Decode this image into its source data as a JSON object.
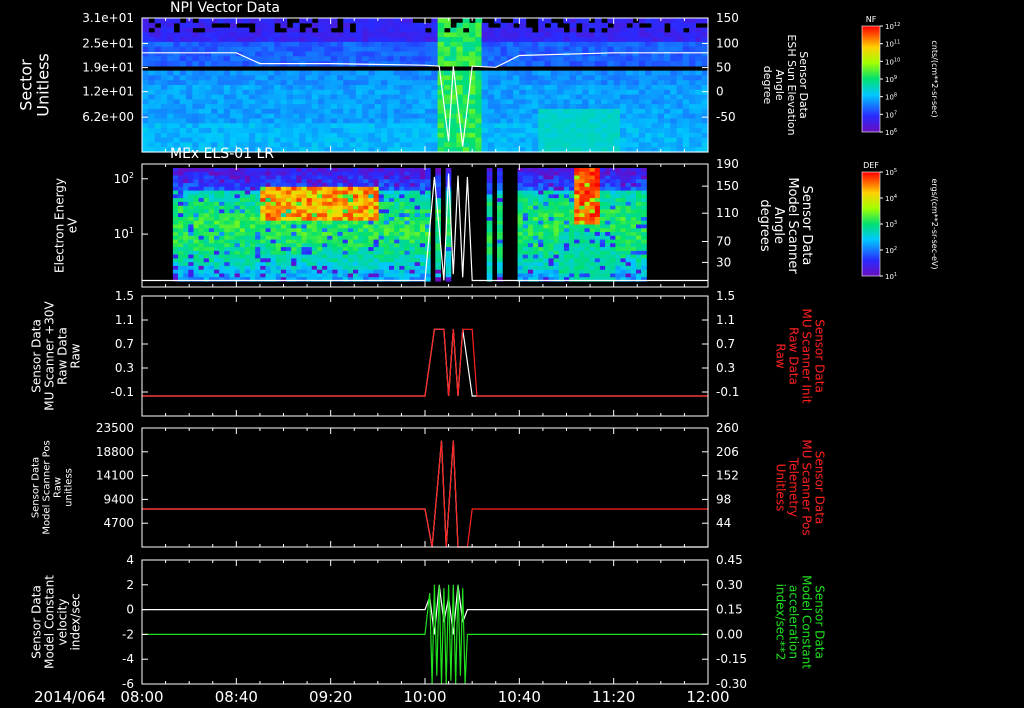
{
  "footer": {
    "date_label": "2014/064",
    "time_ticks": [
      "08:00",
      "08:40",
      "09:20",
      "10:00",
      "10:40",
      "11:20",
      "12:00"
    ]
  },
  "chart_data": [
    {
      "type": "heatmap",
      "title": "NPI Vector Data",
      "ylabel_left": "Sector\nUnitless",
      "yticks_left": [
        "3.1e+01",
        "2.5e+01",
        "1.9e+01",
        "1.2e+01",
        "6.2e+00"
      ],
      "ylabel_right": "Sensor Data\nESH Sun Elevation\nAngle\ndegree",
      "yticks_right": [
        "150",
        "100",
        "50",
        "0",
        "-50"
      ],
      "ylim_right": [
        -100,
        150
      ],
      "overlay_line": {
        "name": "ESH Sun Elevation Angle",
        "color": "#ffffff",
        "x": [
          "08:00",
          "08:40",
          "08:50",
          "09:20",
          "10:00",
          "10:06",
          "10:10",
          "10:12",
          "10:16",
          "10:20",
          "10:30",
          "10:40",
          "11:20",
          "12:00"
        ],
        "y": [
          85,
          85,
          65,
          65,
          62,
          60,
          -80,
          60,
          -90,
          60,
          58,
          80,
          85,
          85
        ]
      },
      "colorbar": {
        "label": "NF",
        "units": "cnts/(cm**2-sr-sec)",
        "ticks": [
          "10^12",
          "10^11",
          "10^10",
          "10^9",
          "10^8",
          "10^7",
          "10^6"
        ]
      }
    },
    {
      "type": "heatmap",
      "title": "MEx ELS-01 LR",
      "ylabel_left": "Electron Energy\neV",
      "yticks_left": [
        "10^2",
        "10^1"
      ],
      "ylabel_right": "Sensor Data\nModel Scanner\nAngle\ndegrees",
      "yticks_right": [
        "190",
        "150",
        "110",
        "70",
        "30"
      ],
      "ylim_right": [
        0,
        190
      ],
      "overlay_line": {
        "name": "Model Scanner Angle",
        "color": "#ffffff",
        "x": [
          "08:00",
          "10:00",
          "10:04",
          "10:08",
          "10:10",
          "10:12",
          "10:14",
          "10:16",
          "10:18",
          "10:20",
          "12:00"
        ],
        "y": [
          10,
          10,
          170,
          10,
          175,
          20,
          172,
          15,
          170,
          10,
          10
        ]
      },
      "colorbar": {
        "label": "DEF",
        "units": "ergs/(cm**2-sr-sec-eV)",
        "ticks": [
          "10^5",
          "10^4",
          "10^3",
          "10^2",
          "10^1"
        ]
      }
    },
    {
      "type": "line",
      "ylabel_left": "Sensor Data\nMU Scanner +30V\nRaw Data\nRaw",
      "yticks_left": [
        "1.5",
        "1.1",
        "0.7",
        "0.3",
        "-0.1"
      ],
      "ylim": [
        -0.3,
        1.5
      ],
      "ylabel_right": "Sensor Data\nMU Scanner Init\nRaw Data\nRaw",
      "yticks_right": [
        "1.5",
        "1.1",
        "0.7",
        "0.3",
        "-0.1"
      ],
      "series": [
        {
          "name": "MU Scanner +30V Raw Data",
          "color": "#ffffff",
          "x": [
            "08:00",
            "10:00",
            "10:04",
            "10:08",
            "10:10",
            "10:12",
            "10:14",
            "10:16",
            "10:20",
            "12:00"
          ],
          "y": [
            0,
            0,
            1,
            1,
            0,
            1,
            0,
            1,
            0,
            0
          ]
        },
        {
          "name": "MU Scanner Init Raw Data",
          "color": "#ff2020",
          "x": [
            "08:00",
            "10:00",
            "10:04",
            "10:08",
            "10:10",
            "10:12",
            "10:14",
            "10:16",
            "10:18",
            "10:20",
            "10:22",
            "12:00"
          ],
          "y": [
            0,
            0,
            1,
            1,
            0,
            1,
            0,
            1,
            1,
            1,
            0,
            0
          ]
        }
      ]
    },
    {
      "type": "line",
      "ylabel_left": "Sensor Data\nModel Scanner Pos\nRaw\nunitless",
      "yticks_left": [
        "23500",
        "18800",
        "14100",
        "9400",
        "4700"
      ],
      "ylim": [
        0,
        23500
      ],
      "ylabel_right": "Sensor Data\nMU Scanner Pos\nTelemetry\nUnitless",
      "yticks_right": [
        "260",
        "206",
        "152",
        "98",
        "44"
      ],
      "ylim_right": [
        0,
        260
      ],
      "series": [
        {
          "name": "Model Scanner Pos Raw",
          "color": "#ffffff",
          "x": [
            "08:00",
            "10:00",
            "10:03",
            "10:07",
            "10:09",
            "10:12",
            "10:14",
            "10:18",
            "12:00"
          ],
          "y": [
            7500,
            7500,
            0,
            21000,
            0,
            21000,
            0,
            0,
            0
          ]
        },
        {
          "name": "MU Scanner Pos Telemetry",
          "color": "#ff2020",
          "x": [
            "08:00",
            "10:00",
            "10:03",
            "10:07",
            "10:09",
            "10:12",
            "10:14",
            "10:18",
            "10:20",
            "12:00"
          ],
          "y": [
            83,
            83,
            0,
            232,
            0,
            232,
            0,
            0,
            83,
            83
          ]
        }
      ]
    },
    {
      "type": "line",
      "ylabel_left": "Sensor Data\nModel Constant\nvelocity\nindex/sec",
      "yticks_left": [
        "4",
        "2",
        "0",
        "-2",
        "-4",
        "-6"
      ],
      "ylim": [
        -6,
        4
      ],
      "ylabel_right": "Sensor Data\nModel Constant\nacceleration\nindex/sec**2",
      "yticks_right": [
        "0.45",
        "0.30",
        "0.15",
        "0.00",
        "-0.15",
        "-0.30"
      ],
      "ylim_right": [
        -0.3,
        0.45
      ],
      "series": [
        {
          "name": "Model Constant velocity",
          "color": "#ffffff",
          "x": [
            "08:00",
            "10:00",
            "10:02",
            "10:04",
            "10:06",
            "10:08",
            "10:10",
            "10:12",
            "10:14",
            "10:16",
            "10:18",
            "12:00"
          ],
          "y": [
            0,
            0,
            1,
            -2,
            2,
            -1,
            1,
            -2,
            2,
            -1,
            0,
            0
          ]
        },
        {
          "name": "Model Constant acceleration",
          "color": "#20e020",
          "x": [
            "08:00",
            "10:00",
            "10:02",
            "10:03",
            "10:04",
            "10:05",
            "10:06",
            "10:07",
            "10:08",
            "10:09",
            "10:10",
            "10:11",
            "10:12",
            "10:13",
            "10:14",
            "10:15",
            "10:16",
            "10:17",
            "10:18",
            "12:00"
          ],
          "y": [
            0,
            0,
            0.25,
            -0.3,
            0.3,
            -0.25,
            0.3,
            -0.3,
            0.28,
            -0.3,
            0.3,
            -0.28,
            0.3,
            -0.3,
            0.3,
            -0.25,
            0.28,
            -0.3,
            0,
            0
          ]
        }
      ]
    }
  ]
}
